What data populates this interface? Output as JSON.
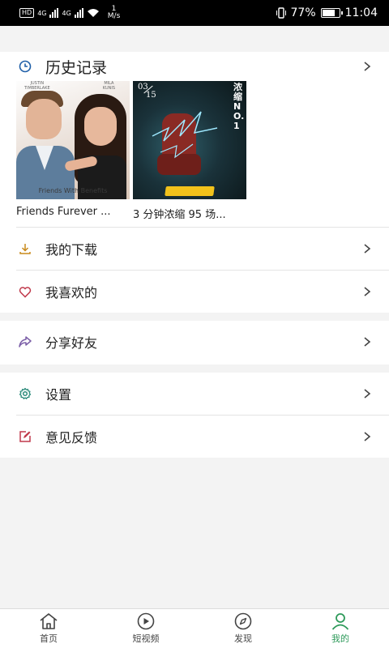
{
  "status": {
    "battery": "77%",
    "time": "11:04",
    "speed": "1",
    "speed_unit": "M/s",
    "net1": "4G",
    "net2": "4G",
    "hd": "HD"
  },
  "history": {
    "title": "历史记录",
    "items": [
      {
        "title": "Friends Furever ..."
      },
      {
        "title": "3 分钟浓缩 95 场..."
      }
    ]
  },
  "menu": {
    "download": "我的下载",
    "favorite": "我喜欢的",
    "share": "分享好友",
    "settings": "设置",
    "feedback": "意见反馈"
  },
  "nav": {
    "items": [
      {
        "label": "首页"
      },
      {
        "label": "短视频"
      },
      {
        "label": "发现"
      },
      {
        "label": "我的"
      }
    ],
    "active_color": "#2e9a5a"
  },
  "posters": {
    "p1": {
      "top_names": [
        "JUSTIN",
        "MILA"
      ],
      "bottom_names": [
        "TIMBERLAKE",
        "KUNIS"
      ],
      "tagline": "Friends With Benefits"
    },
    "p2": {
      "date_top": "03",
      "date_bottom": "15",
      "side_text": "浓缩NO.1"
    }
  }
}
